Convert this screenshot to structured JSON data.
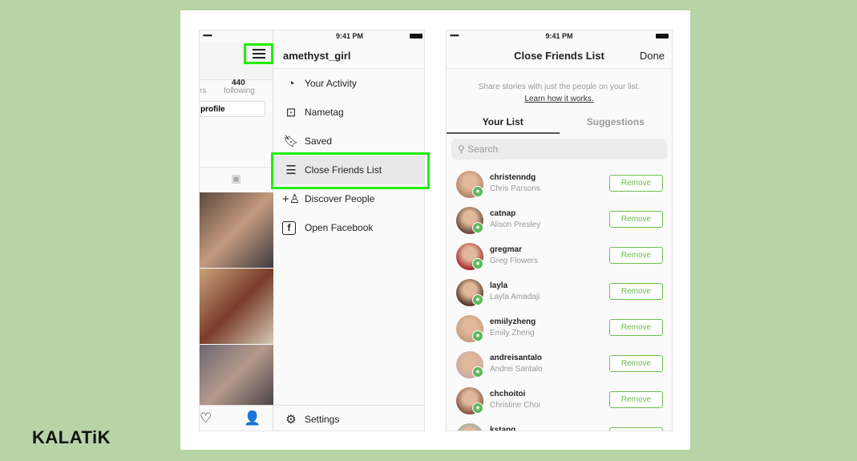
{
  "status": {
    "time": "9:41 PM",
    "signal": "•••••"
  },
  "profile": {
    "followers_partial": "rs",
    "following_count": "440",
    "following_label": "following",
    "edit_partial": "profile"
  },
  "menu": {
    "username": "amethyst_girl",
    "items": [
      {
        "label": "Your Activity",
        "icon": "activity-icon"
      },
      {
        "label": "Nametag",
        "icon": "nametag-icon"
      },
      {
        "label": "Saved",
        "icon": "bookmark-icon"
      },
      {
        "label": "Close Friends List",
        "icon": "list-icon"
      },
      {
        "label": "Discover People",
        "icon": "add-person-icon"
      },
      {
        "label": "Open Facebook",
        "icon": "facebook-icon"
      }
    ],
    "settings": "Settings"
  },
  "close_friends": {
    "title": "Close Friends List",
    "done": "Done",
    "description": "Share stories with just the people on your list.",
    "learn_link": "Learn how it works.",
    "tabs": [
      "Your List",
      "Suggestions"
    ],
    "search_placeholder": "Search",
    "remove_label": "Remove",
    "people": [
      {
        "username": "christenndg",
        "name": "Chris Parsons"
      },
      {
        "username": "catnap",
        "name": "Alison Presley"
      },
      {
        "username": "gregmar",
        "name": "Greg Flowers"
      },
      {
        "username": "layla",
        "name": "Layla Amadaji"
      },
      {
        "username": "emiilyzheng",
        "name": "Emily Zheng"
      },
      {
        "username": "andreisantalo",
        "name": "Andrei Santalo"
      },
      {
        "username": "chchoitoi",
        "name": "Christine Choi"
      },
      {
        "username": "kstang",
        "name": ""
      }
    ]
  },
  "brand": {
    "logo": "KALATiK",
    "accent": "#22ee00",
    "remove_color": "#6bbf4e"
  }
}
